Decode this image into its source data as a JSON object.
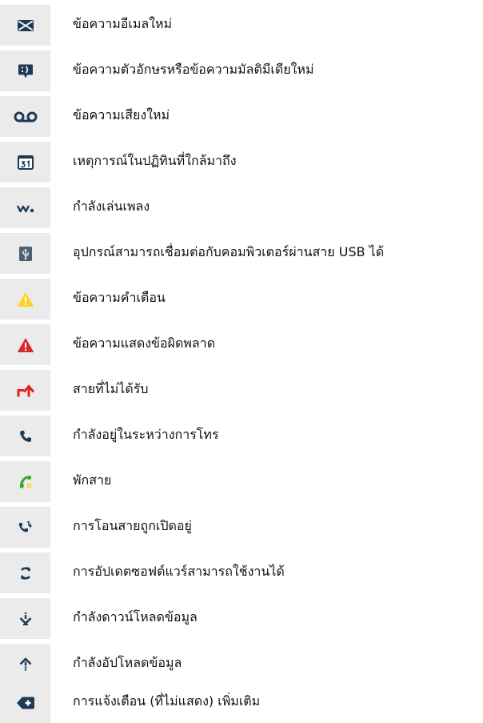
{
  "items": [
    {
      "icon": "email-icon",
      "label": "ข้อความอีเมลใหม่"
    },
    {
      "icon": "text-message-icon",
      "label": "ข้อความตัวอักษรหรือข้อความมัลติมีเดียใหม่"
    },
    {
      "icon": "voicemail-icon",
      "label": "ข้อความเสียงใหม่"
    },
    {
      "icon": "calendar-icon",
      "label": "เหตุการณ์ในปฏิทินที่ใกล้มาถึง"
    },
    {
      "icon": "walkman-icon",
      "label": "กำลังเล่นเพลง"
    },
    {
      "icon": "usb-icon",
      "label": "อุปกรณ์สามารถเชื่อมต่อกับคอมพิวเตอร์ผ่านสาย USB ได้"
    },
    {
      "icon": "warning-icon",
      "label": "ข้อความคำเตือน"
    },
    {
      "icon": "error-icon",
      "label": "ข้อความแสดงข้อผิดพลาด"
    },
    {
      "icon": "missed-call-icon",
      "label": "สายที่ไม่ได้รับ"
    },
    {
      "icon": "call-in-progress-icon",
      "label": "กำลังอยู่ในระหว่างการโทร"
    },
    {
      "icon": "call-on-hold-icon",
      "label": "พักสาย"
    },
    {
      "icon": "call-forwarding-icon",
      "label": "การโอนสายถูกเปิดอยู่"
    },
    {
      "icon": "software-update-icon",
      "label": "การอัปเดตซอฟต์แวร์สามารถใช้งานได้"
    },
    {
      "icon": "download-icon",
      "label": "กำลังดาวน์โหลดข้อมูล"
    },
    {
      "icon": "upload-icon",
      "label": "กำลังอัปโหลดข้อมูล"
    },
    {
      "icon": "more-notifications-icon",
      "label": "การแจ้งเตือน (ที่ไม่แสดง) เพิ่มเติม"
    }
  ],
  "colors": {
    "icon_background": "#ebebeb",
    "icon_dark": "#1c3a54",
    "warning_yellow": "#ffd21f",
    "error_red": "#d62a2a",
    "missed_call_red": "#e0241b",
    "hold_green": "#3aa52c"
  }
}
